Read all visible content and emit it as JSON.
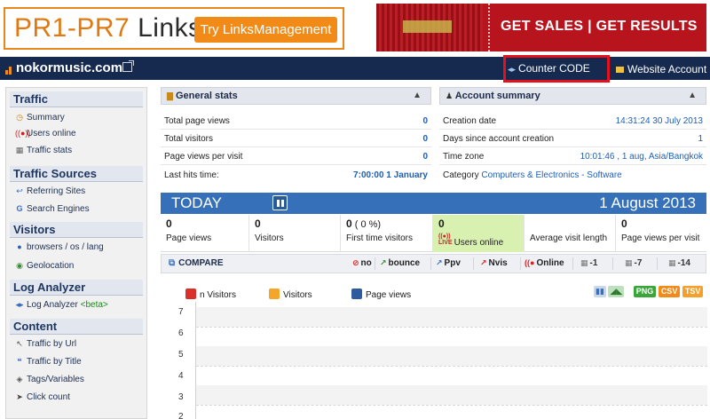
{
  "banner": {
    "ad_left_title": "PR1-PR7",
    "ad_left_title_links": "Links",
    "ad_left_button": "Try LinksManagement",
    "ad_right_text": "GET SALES | GET RESULTS"
  },
  "header": {
    "site_name": "nokormusic.com",
    "counter_code": "Counter CODE",
    "website_account": "Website Account"
  },
  "sidebar": {
    "traffic": {
      "title": "Traffic",
      "items": [
        {
          "icon": "clock-icon",
          "label": "Summary"
        },
        {
          "icon": "live-icon",
          "label": "Users online"
        },
        {
          "icon": "table-icon",
          "label": "Traffic stats"
        }
      ]
    },
    "traffic_sources": {
      "title": "Traffic Sources",
      "items": [
        {
          "icon": "arrow-icon",
          "label": "Referring Sites"
        },
        {
          "icon": "google-icon",
          "label": "Search Engines"
        }
      ]
    },
    "visitors": {
      "title": "Visitors",
      "items": [
        {
          "icon": "info-icon",
          "label": "browsers / os / lang"
        },
        {
          "icon": "globe-icon",
          "label": "Geolocation"
        }
      ]
    },
    "log_analyzer": {
      "title": "Log Analyzer",
      "items": [
        {
          "icon": "code-icon",
          "label": "Log Analyzer",
          "badge": "<beta>"
        }
      ]
    },
    "content": {
      "title": "Content",
      "items": [
        {
          "icon": "link-icon",
          "label": "Traffic by Url"
        },
        {
          "icon": "quote-icon",
          "label": "Traffic by Title"
        },
        {
          "icon": "tag-icon",
          "label": "Tags/Variables"
        },
        {
          "icon": "cursor-icon",
          "label": "Click count"
        }
      ]
    }
  },
  "general_stats": {
    "title": "General stats",
    "rows": [
      {
        "label": "Total page views",
        "value": "0"
      },
      {
        "label": "Total visitors",
        "value": "0"
      },
      {
        "label": "Page views per visit",
        "value": "0"
      },
      {
        "label": "Last hits time:",
        "value": "7:00:00 1 January"
      }
    ]
  },
  "account_summary": {
    "title": "Account summary",
    "rows": [
      {
        "label": "Creation date",
        "value": "14:31:24 30 July 2013"
      },
      {
        "label": "Days since account creation",
        "value": "1"
      },
      {
        "label": "Time zone",
        "value": "10:01:46 , 1 aug, Asia/Bangkok"
      }
    ],
    "category_label": "Category",
    "category_value": "Computers & Electronics - Software"
  },
  "today": {
    "label": "TODAY",
    "date": "1 August 2013",
    "stats": [
      {
        "value": "0",
        "extra": "",
        "caption": "Page views"
      },
      {
        "value": "0",
        "extra": "",
        "caption": "Visitors"
      },
      {
        "value": "0",
        "extra": " ( 0 %)",
        "caption": "First time visitors"
      },
      {
        "value": "0",
        "extra": "",
        "caption": "Users online"
      },
      {
        "value": "",
        "extra": "",
        "caption": "Average visit length"
      },
      {
        "value": "0",
        "extra": "",
        "caption": "Page views per visit"
      }
    ]
  },
  "compare": {
    "label": "COMPARE",
    "options": [
      "no",
      "bounce",
      "Ppv",
      "Nvis",
      "Online",
      "-1",
      "-7",
      "-14"
    ]
  },
  "chart": {
    "legend": [
      {
        "name": "n Visitors",
        "color": "#d9302a"
      },
      {
        "name": "Visitors",
        "color": "#f4a62a"
      },
      {
        "name": "Page views",
        "color": "#2e5b9e"
      }
    ],
    "export": [
      "PNG",
      "CSV",
      "TSV"
    ],
    "y_ticks": [
      "7",
      "6",
      "5",
      "4",
      "3",
      "2"
    ]
  },
  "chart_data": {
    "type": "bar",
    "series": [
      {
        "name": "n Visitors",
        "values": []
      },
      {
        "name": "Visitors",
        "values": []
      },
      {
        "name": "Page views",
        "values": []
      }
    ],
    "y_ticks": [
      7,
      6,
      5,
      4,
      3,
      2
    ],
    "grid": true
  }
}
